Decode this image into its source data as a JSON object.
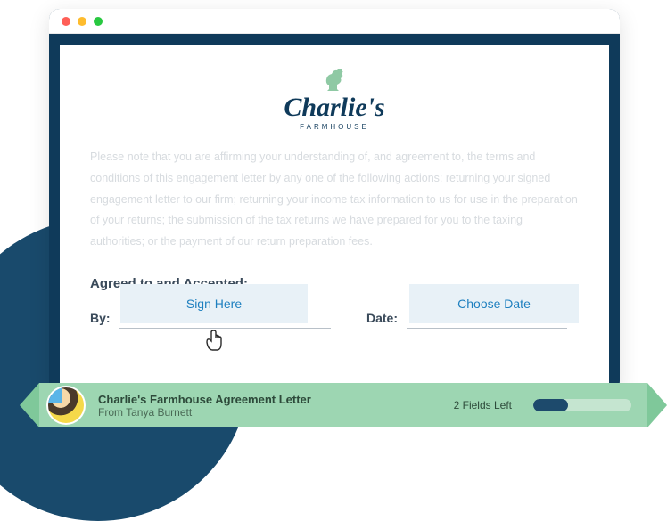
{
  "logo": {
    "name": "Charlie's",
    "sub": "FARMHOUSE"
  },
  "document": {
    "body": "Please note that you are affirming your understanding of, and agreement to, the terms and conditions of this engagement letter by any one of the following actions: returning your signed engagement letter to our firm; returning your income tax information to us for use in the preparation of your returns; the submission of the tax returns we have prepared for you to the taxing authorities; or the payment of our return preparation fees.",
    "agreed_label": "Agreed to and Accepted:",
    "fields": {
      "by_label": "By:",
      "date_label": "Date:",
      "sign_button": "Sign Here",
      "date_button": "Choose Date"
    }
  },
  "status": {
    "title": "Charlie's Farmhouse Agreement Letter",
    "from": "From Tanya Burnett",
    "fields_left": "2 Fields Left",
    "progress_percent": 35
  }
}
